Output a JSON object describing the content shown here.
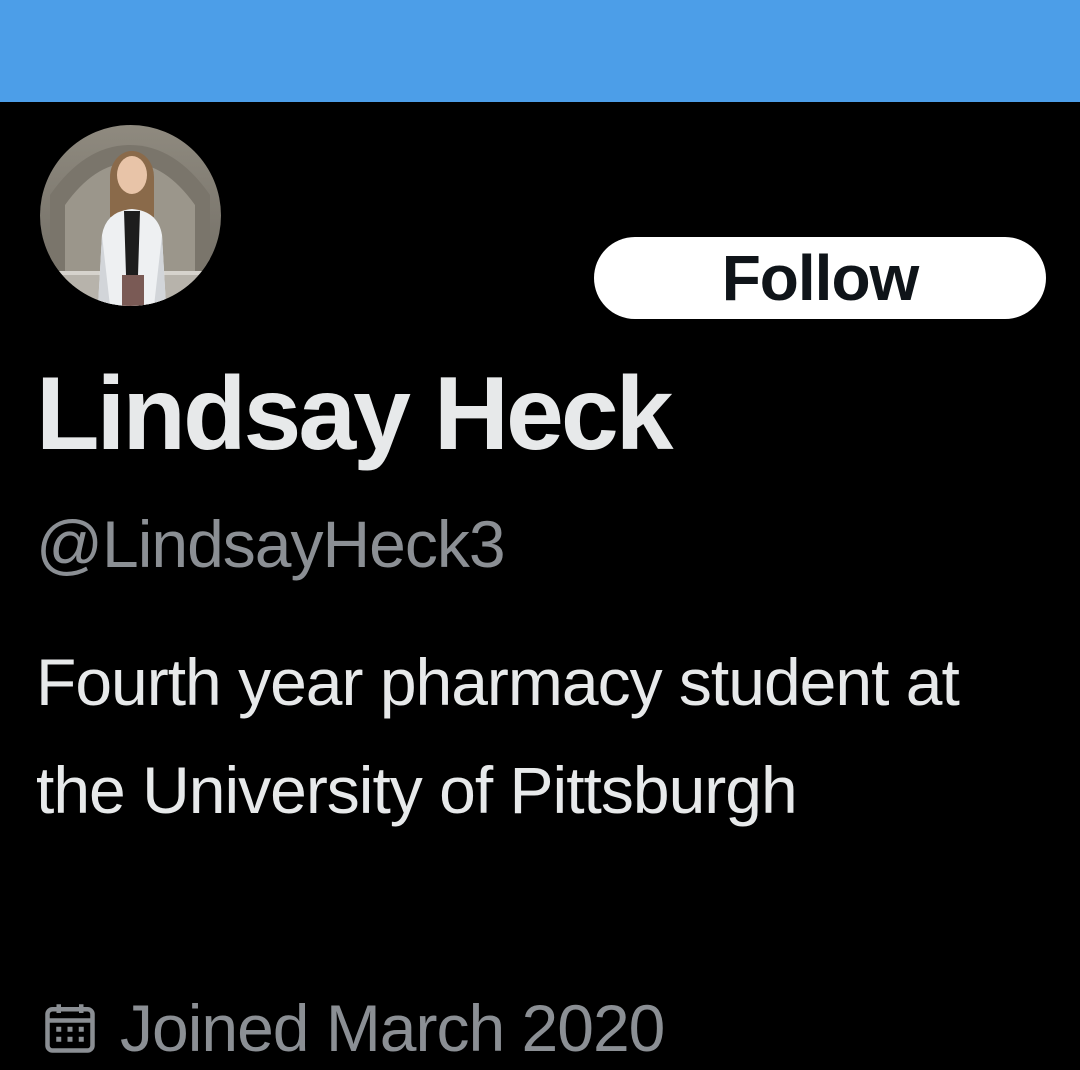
{
  "colors": {
    "banner": "#4c9ee8",
    "background": "#000000",
    "primary_text": "#e7e9ea",
    "secondary_text": "#8b8f94",
    "follow_bg": "#ffffff",
    "follow_text": "#0f1419"
  },
  "profile": {
    "avatar_icon": "user-avatar-photo",
    "follow_label": "Follow",
    "display_name": "Lindsay Heck",
    "handle": "@LindsayHeck3",
    "bio": "Fourth year pharmacy student at the University of Pittsburgh",
    "joined_icon": "calendar-icon",
    "joined": "Joined March 2020"
  }
}
